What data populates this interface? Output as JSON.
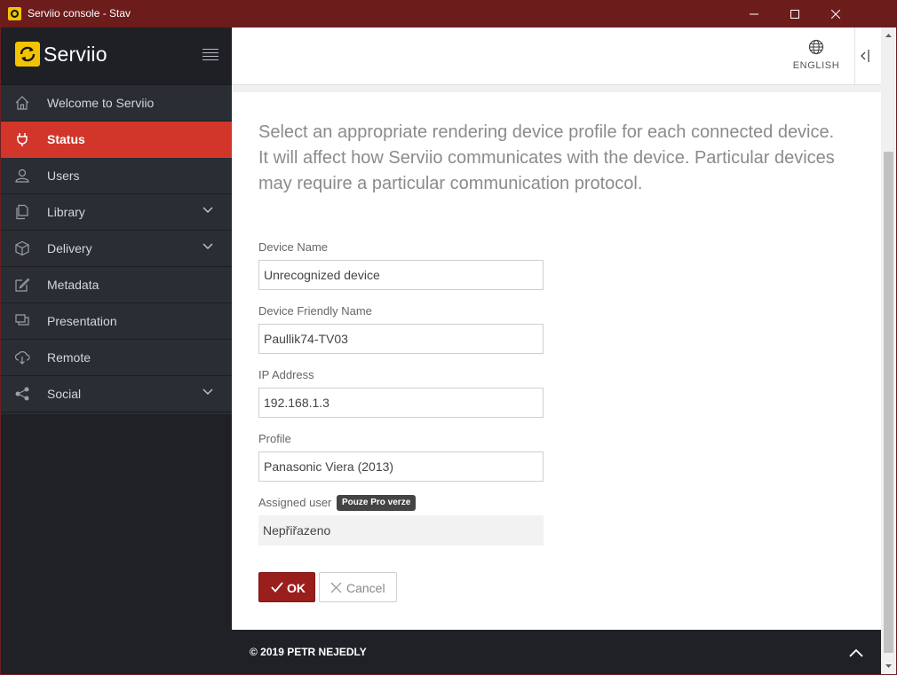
{
  "window": {
    "title": "Serviio console - Stav"
  },
  "sidebar": {
    "brand": "Serviio",
    "items": [
      {
        "label": "Welcome to Serviio",
        "icon": "home-icon",
        "active": false,
        "expandable": false
      },
      {
        "label": "Status",
        "icon": "plug-icon",
        "active": true,
        "expandable": false
      },
      {
        "label": "Users",
        "icon": "user-icon",
        "active": false,
        "expandable": false
      },
      {
        "label": "Library",
        "icon": "files-icon",
        "active": false,
        "expandable": true
      },
      {
        "label": "Delivery",
        "icon": "cube-icon",
        "active": false,
        "expandable": true
      },
      {
        "label": "Metadata",
        "icon": "edit-icon",
        "active": false,
        "expandable": false
      },
      {
        "label": "Presentation",
        "icon": "presentation-icon",
        "active": false,
        "expandable": false
      },
      {
        "label": "Remote",
        "icon": "cloud-icon",
        "active": false,
        "expandable": false
      },
      {
        "label": "Social",
        "icon": "share-icon",
        "active": false,
        "expandable": true
      }
    ]
  },
  "topbar": {
    "language": "ENGLISH"
  },
  "main": {
    "intro": "Select an appropriate rendering device profile for each connected device. It will affect how Serviio communicates with the device. Particular devices may require a particular communication protocol.",
    "fields": {
      "device_name": {
        "label": "Device Name",
        "value": "Unrecognized device"
      },
      "friendly_name": {
        "label": "Device Friendly Name",
        "value": "Paullik74-TV03"
      },
      "ip_address": {
        "label": "IP Address",
        "value": "192.168.1.3"
      },
      "profile": {
        "label": "Profile",
        "value": "Panasonic Viera (2013)"
      },
      "assigned_user": {
        "label": "Assigned user",
        "badge": "Pouze Pro verze",
        "value": "Nepřiřazeno"
      }
    },
    "buttons": {
      "ok": "OK",
      "cancel": "Cancel"
    }
  },
  "footer": {
    "copyright": "© 2019 PETR NEJEDLY"
  },
  "colors": {
    "accent": "#d2352a",
    "ok_button": "#9a1e1c",
    "titlebar": "#6d1c1c",
    "sidebar": "#2a2d33",
    "logo": "#f2c400"
  }
}
